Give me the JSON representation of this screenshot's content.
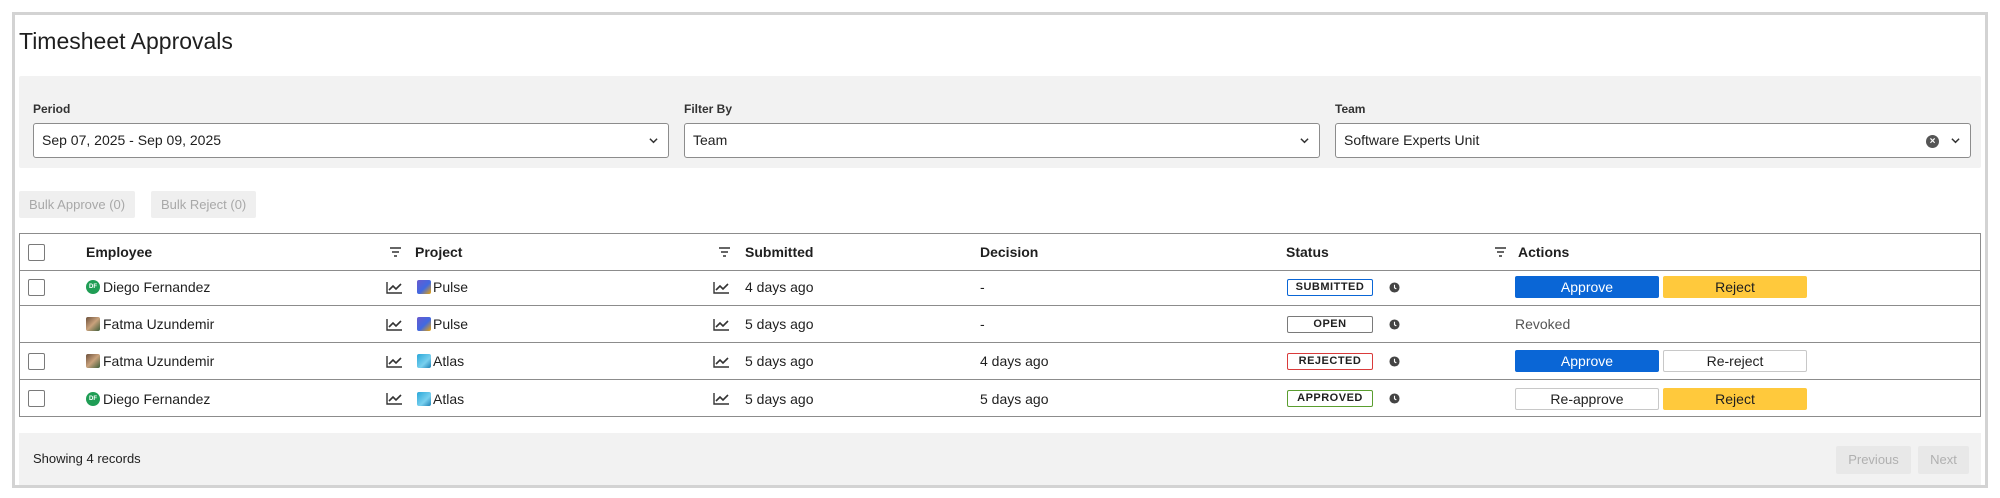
{
  "page": {
    "title": "Timesheet Approvals"
  },
  "filters": {
    "period": {
      "label": "Period",
      "value": "Sep 07, 2025 - Sep 09, 2025"
    },
    "filter_by": {
      "label": "Filter By",
      "value": "Team"
    },
    "team": {
      "label": "Team",
      "value": "Software Experts Unit"
    }
  },
  "bulk": {
    "approve_label": "Bulk Approve (0)",
    "reject_label": "Bulk Reject (0)"
  },
  "table": {
    "headers": {
      "employee": "Employee",
      "project": "Project",
      "submitted": "Submitted",
      "decision": "Decision",
      "status": "Status",
      "actions": "Actions"
    },
    "rows": [
      {
        "employee": "Diego Fernandez",
        "avatar_initials": "DF",
        "project": "Pulse",
        "submitted": "4 days ago",
        "decision": "-",
        "status": "SUBMITTED",
        "status_color": "#0a66d6",
        "action1": "Approve",
        "action2": "Reject"
      },
      {
        "employee": "Fatma Uzundemir",
        "project": "Pulse",
        "submitted": "5 days ago",
        "decision": "-",
        "status": "OPEN",
        "status_color": "#7a7a7a",
        "action_text": "Revoked"
      },
      {
        "employee": "Fatma Uzundemir",
        "project": "Atlas",
        "submitted": "5 days ago",
        "decision": "4 days ago",
        "status": "REJECTED",
        "status_color": "#d93b3b",
        "action1": "Approve",
        "action2": "Re-reject"
      },
      {
        "employee": "Diego Fernandez",
        "avatar_initials": "DF",
        "project": "Atlas",
        "submitted": "5 days ago",
        "decision": "5 days ago",
        "status": "APPROVED",
        "status_color": "#5a9e2f",
        "action1": "Re-approve",
        "action2": "Reject"
      }
    ]
  },
  "footer": {
    "records_text": "Showing 4 records",
    "prev_label": "Previous",
    "next_label": "Next"
  },
  "icons": {
    "sort": "filter-lines-icon",
    "trend": "trend-chart-icon",
    "clock": "clock-icon",
    "chevron": "chevron-down-icon",
    "clear": "clear-icon"
  },
  "colors": {
    "primary": "#0a66d6",
    "warning": "#ffc93c"
  }
}
